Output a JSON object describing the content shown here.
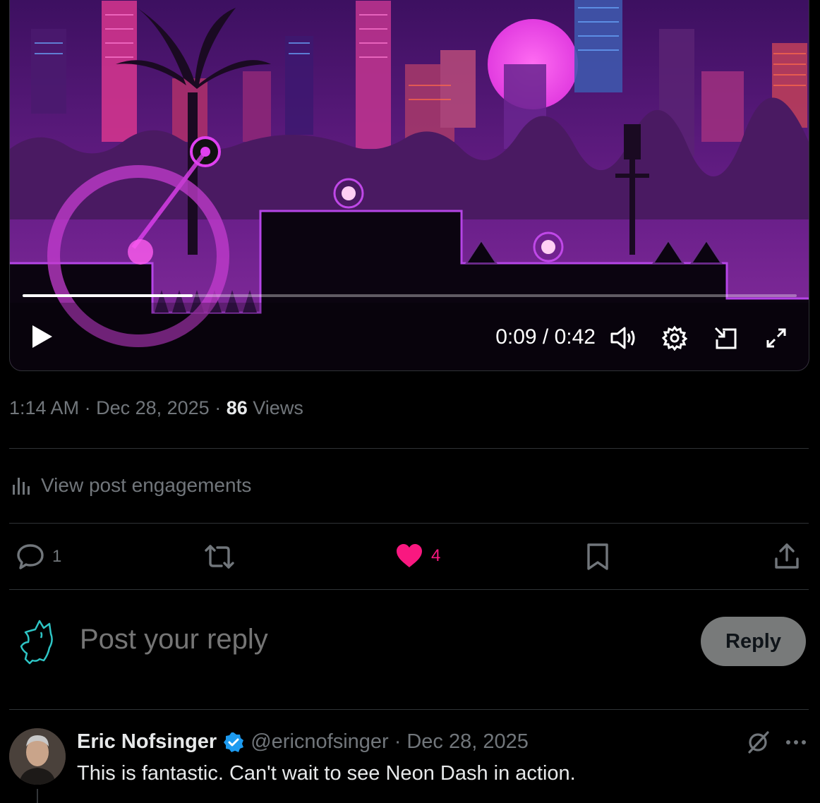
{
  "video": {
    "current_time": "0:09",
    "duration": "0:42",
    "time_display": "0:09 / 0:42",
    "progress_fraction": 0.22
  },
  "post_meta": {
    "time": "1:14 AM",
    "date": "Dec 28, 2025",
    "views_count": "86",
    "views_label": "Views"
  },
  "engagements_label": "View post engagements",
  "actions": {
    "reply_count": "1",
    "like_count": "4"
  },
  "reply_box": {
    "placeholder": "Post your reply",
    "button_label": "Reply"
  },
  "comment": {
    "name": "Eric Nofsinger",
    "handle": "@ericnofsinger",
    "date": "Dec 28, 2025",
    "text": "This is fantastic. Can't wait to see Neon Dash in action."
  },
  "colors": {
    "like_pink": "#f91880",
    "verified_blue": "#1d9bf0",
    "muted_text": "#71767b",
    "divider": "#2f3336"
  }
}
